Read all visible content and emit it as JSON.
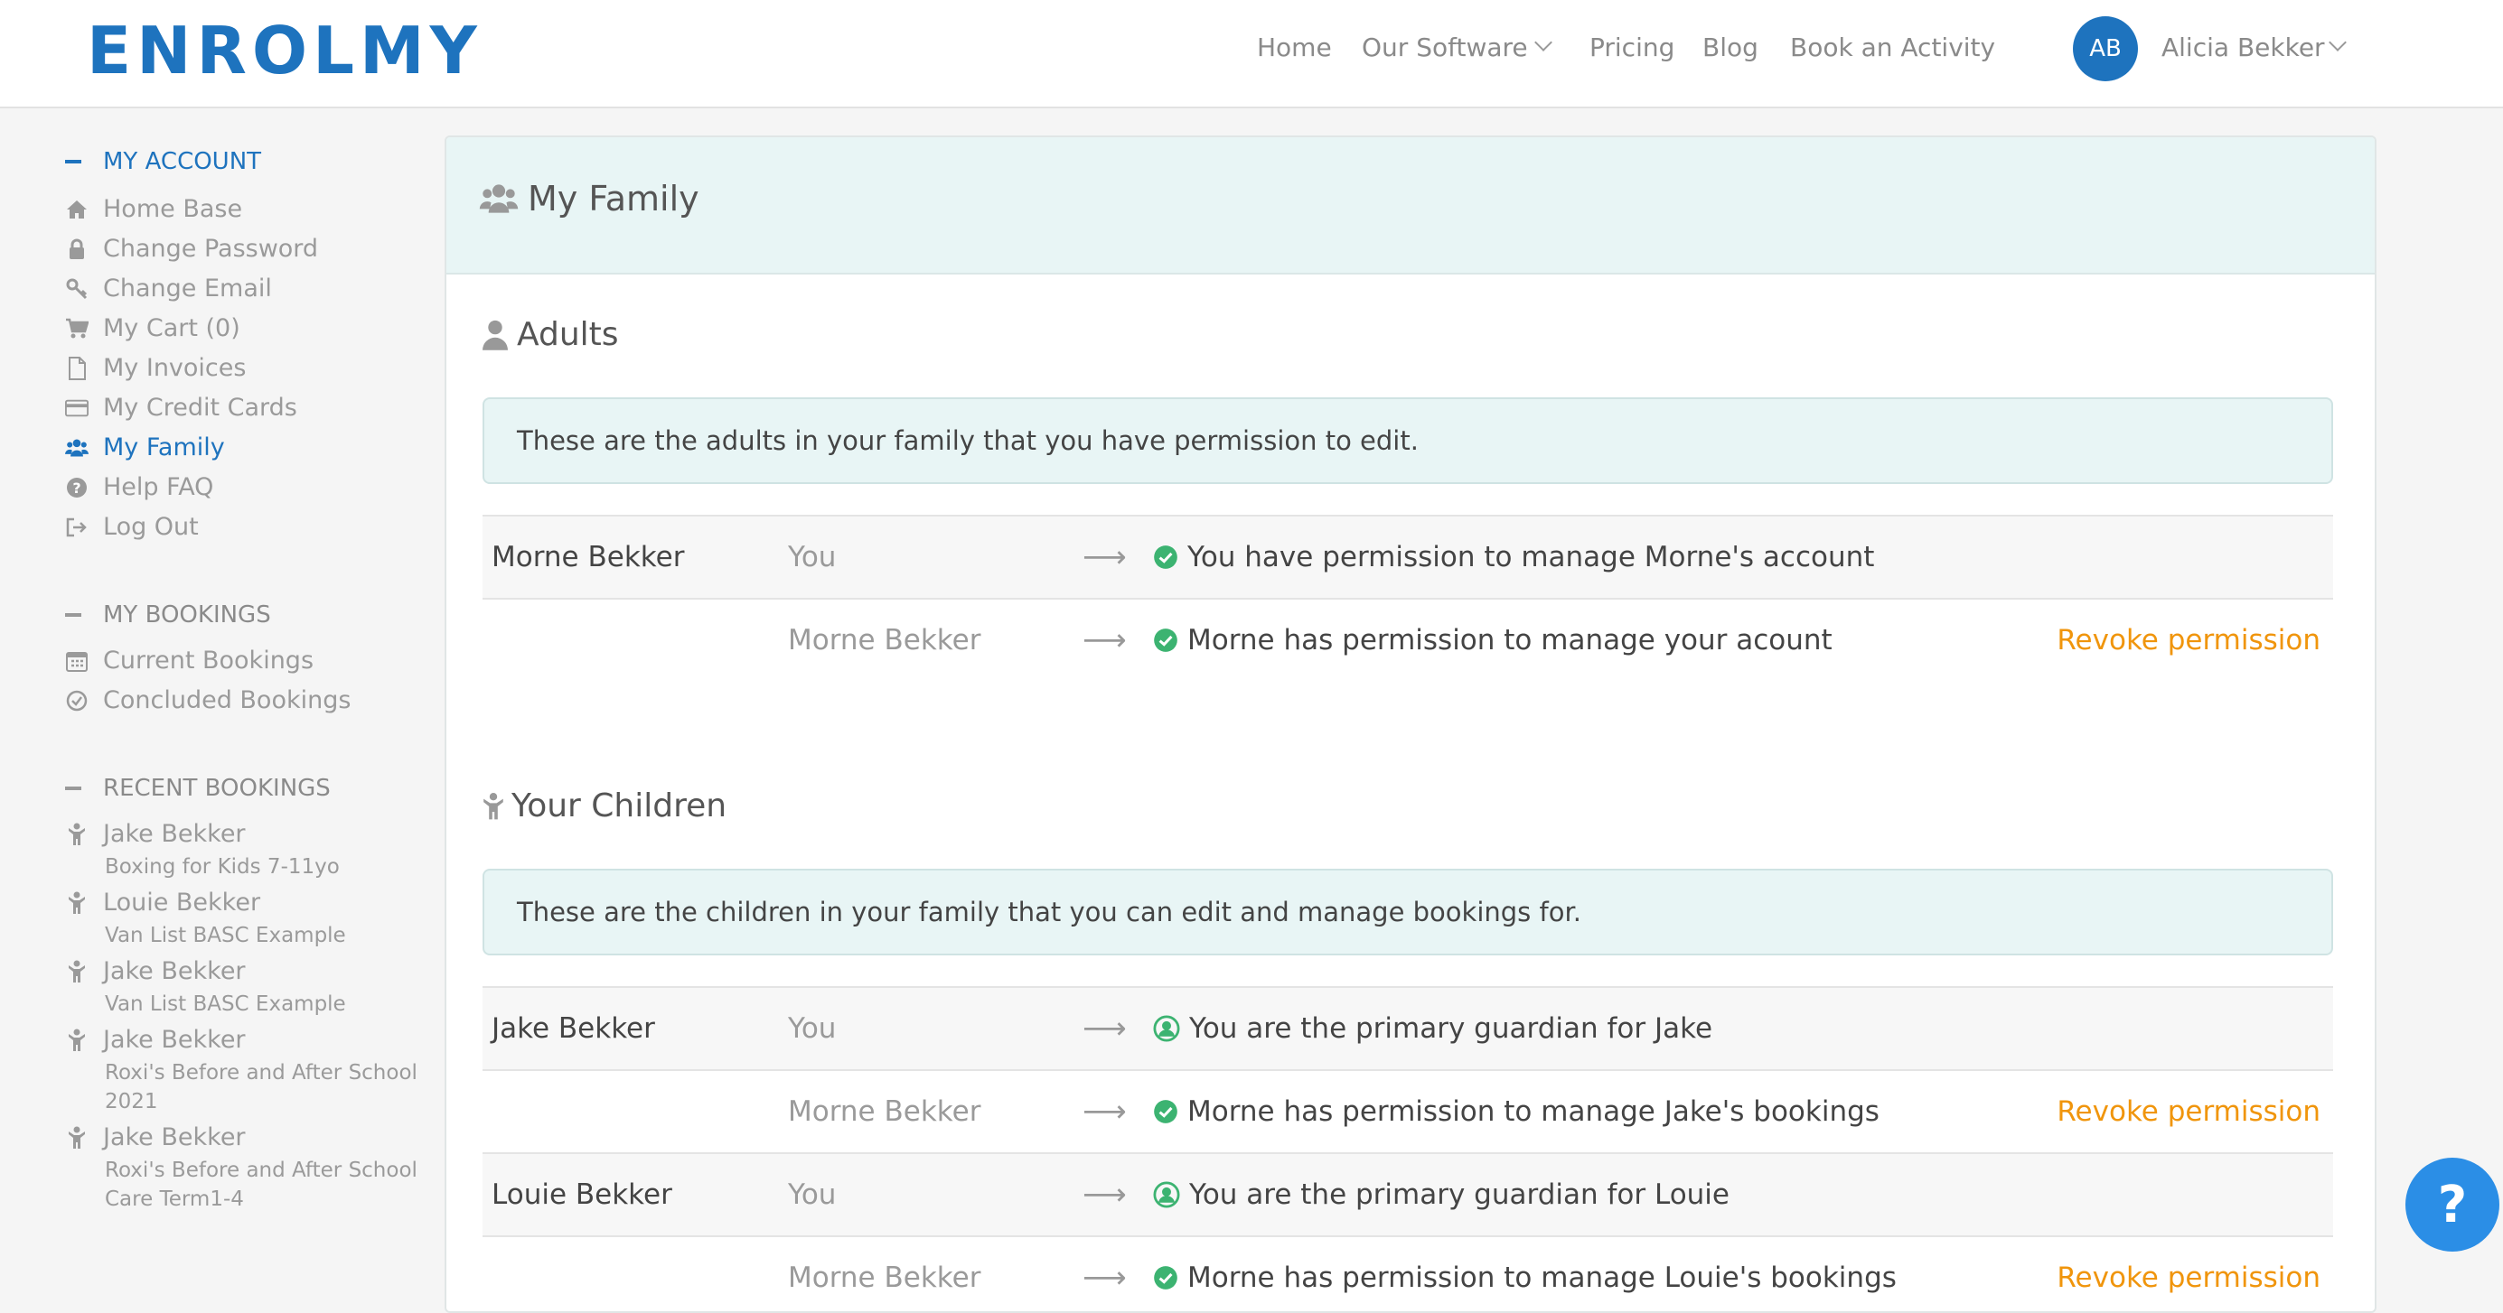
{
  "brand": {
    "logo_text": "ENROLMY",
    "color": "#1e73be"
  },
  "nav": {
    "home": "Home",
    "our_software": "Our Software",
    "pricing": "Pricing",
    "blog": "Blog",
    "book_activity": "Book an Activity",
    "user_initials": "AB",
    "user_name": "Alicia Bekker"
  },
  "sidebar": {
    "my_account": {
      "heading": "MY ACCOUNT",
      "items": [
        {
          "label": "Home Base",
          "icon": "home-icon"
        },
        {
          "label": "Change Password",
          "icon": "lock-icon"
        },
        {
          "label": "Change Email",
          "icon": "key-icon"
        },
        {
          "label": "My Cart (0)",
          "icon": "cart-icon"
        },
        {
          "label": "My Invoices",
          "icon": "file-icon"
        },
        {
          "label": "My Credit Cards",
          "icon": "credit-card-icon"
        },
        {
          "label": "My Family",
          "icon": "users-icon",
          "active": true
        },
        {
          "label": "Help FAQ",
          "icon": "question-circle-icon"
        },
        {
          "label": "Log Out",
          "icon": "sign-out-icon"
        }
      ]
    },
    "my_bookings": {
      "heading": "MY BOOKINGS",
      "items": [
        {
          "label": "Current Bookings",
          "icon": "calendar-icon"
        },
        {
          "label": "Concluded Bookings",
          "icon": "check-circle-icon"
        }
      ]
    },
    "recent_bookings": {
      "heading": "RECENT BOOKINGS",
      "items": [
        {
          "name": "Jake Bekker",
          "activity": "Boxing for Kids 7-11yo"
        },
        {
          "name": "Louie Bekker",
          "activity": "Van List BASC Example"
        },
        {
          "name": "Jake Bekker",
          "activity": "Van List BASC Example"
        },
        {
          "name": "Jake Bekker",
          "activity_line1": "Roxi's Before and After School",
          "activity_line2": "2021"
        },
        {
          "name": "Jake Bekker",
          "activity_line1": "Roxi's Before and After School",
          "activity_line2": "Care Term1-4"
        }
      ]
    }
  },
  "main": {
    "title": "My Family",
    "adults": {
      "title": "Adults",
      "info": "These are the adults in your family that you have permission to edit.",
      "rows": [
        {
          "name": "Morne Bekker",
          "who": "You",
          "desc": "You have permission to manage Morne's account",
          "action": ""
        },
        {
          "name": "",
          "who": "Morne Bekker",
          "desc": "Morne has permission to manage your acount",
          "action": "Revoke permission"
        }
      ]
    },
    "children": {
      "title": "Your Children",
      "info": "These are the children in your family that you can edit and manage bookings for.",
      "rows": [
        {
          "name": "Jake Bekker",
          "who": "You",
          "desc": "You are the primary guardian for Jake",
          "action": "",
          "status": "guardian"
        },
        {
          "name": "",
          "who": "Morne Bekker",
          "desc": "Morne has permission to manage Jake's bookings",
          "action": "Revoke permission",
          "status": "permission"
        },
        {
          "name": "Louie Bekker",
          "who": "You",
          "desc": "You are the primary guardian for Louie",
          "action": "",
          "status": "guardian"
        },
        {
          "name": "",
          "who": "Morne Bekker",
          "desc": "Morne has permission to manage Louie's bookings",
          "action": "Revoke permission",
          "status": "permission"
        }
      ]
    }
  },
  "help_button": "?",
  "colors": {
    "accent": "#1e73be",
    "action": "#f0950c",
    "success": "#3cb371",
    "panel_header": "#e8f5f5"
  }
}
